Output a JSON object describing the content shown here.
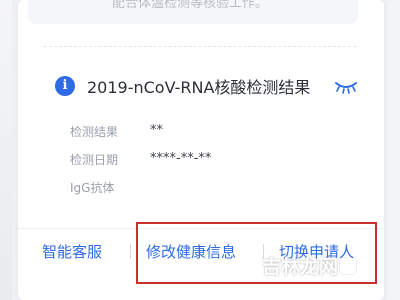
{
  "top_banner": {
    "text": "配合体温检测等核验工作。"
  },
  "result_card": {
    "title": "2019-nCoV-RNA核酸检测结果",
    "icons": {
      "info": "info-icon",
      "toggle": "eye-closed-icon"
    },
    "fields": [
      {
        "label": "检测结果",
        "value": "**"
      },
      {
        "label": "检测日期",
        "value": "****-**-**"
      },
      {
        "label": "IgG抗体",
        "value": ""
      }
    ]
  },
  "footer": {
    "links": [
      {
        "label": "智能客服"
      },
      {
        "label": "修改健康信息"
      },
      {
        "label": "切换申请人"
      }
    ]
  },
  "watermark": {
    "text": "吉林龙网"
  },
  "colors": {
    "accent": "#2e6be6",
    "highlight_box": "#c7302d",
    "label_gray": "#9aa0ab",
    "title_text": "#2b2f36"
  }
}
